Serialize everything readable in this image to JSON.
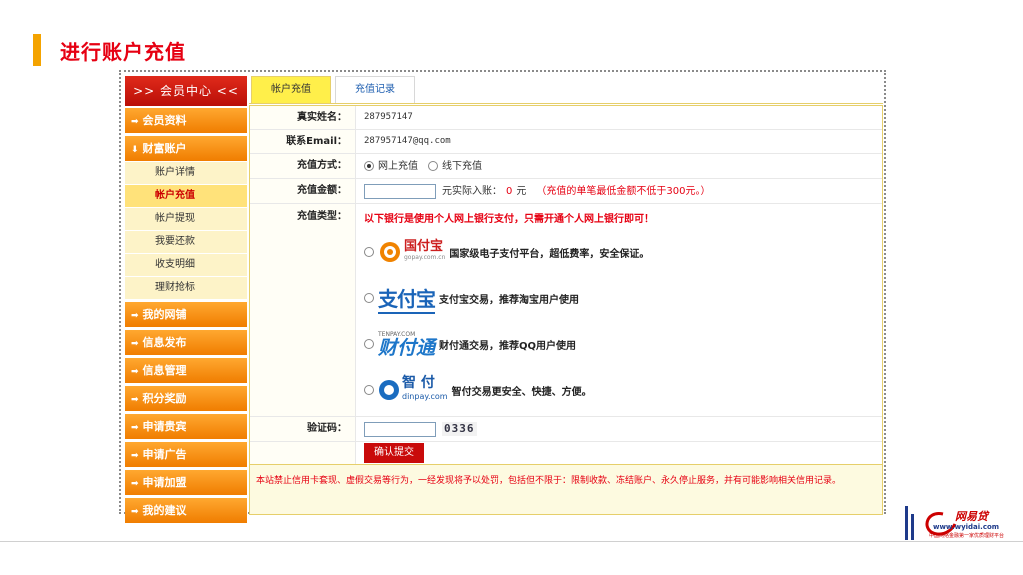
{
  "slide": {
    "title": "进行账户充值"
  },
  "sidebar": {
    "header": ">> 会员中心 <<",
    "items": [
      {
        "label": "会员资料",
        "arrow": "➡"
      },
      {
        "label": "财富账户",
        "arrow": "⬇"
      }
    ],
    "sub_items": [
      "账户详情",
      "帐户充值",
      "帐户提现",
      "我要还款",
      "收支明细",
      "理财抢标"
    ],
    "more_items": [
      "我的网铺",
      "信息发布",
      "信息管理",
      "积分奖励",
      "申请贵宾",
      "申请广告",
      "申请加盟",
      "我的建议"
    ]
  },
  "tabs": [
    "帐户充值",
    "充值记录"
  ],
  "form": {
    "name_label": "真实姓名：",
    "name_value": "287957147",
    "email_label": "联系Email：",
    "email_value": "287957147@qq.com",
    "method_label": "充值方式：",
    "method_online": "网上充值",
    "method_offline": "线下充值",
    "amount_label": "充值金额：",
    "amount_suffix": "元实际入账：",
    "amount_actual": "0",
    "amount_unit": "元",
    "amount_note": "（充值的单笔最低金额不低于300元。）",
    "type_label": "充值类型：",
    "type_note": "以下银行是使用个人网上银行支付，只需开通个人网上银行即可！",
    "banks": [
      {
        "logo_text": "国付宝",
        "logo_sub": "gopay.com.cn",
        "desc": "国家级电子支付平台，超低费率，安全保证。"
      },
      {
        "logo_text": "支付宝",
        "desc": "支付宝交易，推荐淘宝用户使用"
      },
      {
        "logo_text": "财付通",
        "logo_sub": "TENPAY.COM",
        "desc": "财付通交易，推荐QQ用户使用"
      },
      {
        "logo_text": "智 付",
        "logo_sub": "dinpay.com",
        "desc": "智付交易更安全、快捷、方便。"
      }
    ],
    "captcha_label": "验证码：",
    "captcha_value": "0336",
    "submit_label": "确认提交"
  },
  "notice": "本站禁止信用卡套现、虚假交易等行为，一经发现将予以处罚，包括但不限于：限制收款、冻结账户、永久停止服务，并有可能影响相关信用记录。",
  "brand": {
    "name": "网易贷",
    "url": "www.wyidai.com",
    "slogan": "中国网络金融第一家优质理财平台"
  }
}
